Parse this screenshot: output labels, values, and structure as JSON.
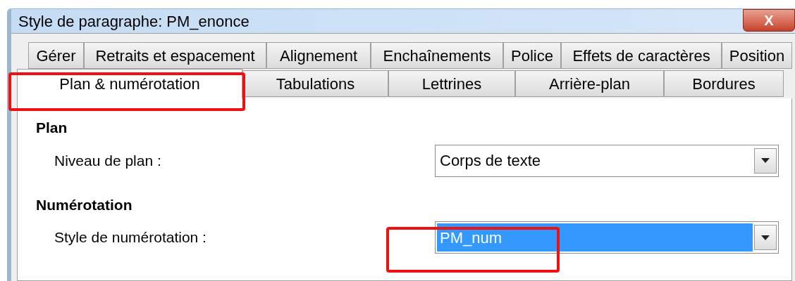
{
  "window": {
    "title": "Style de paragraphe: PM_enonce",
    "close_button": "X"
  },
  "tabs": [
    [
      {
        "label": "Gérer",
        "selected": false,
        "highlighted": false
      },
      {
        "label": "Retraits et espacement",
        "selected": false,
        "highlighted": false
      },
      {
        "label": "Alignement",
        "selected": false,
        "highlighted": false
      },
      {
        "label": "Enchaînements",
        "selected": false,
        "highlighted": false
      },
      {
        "label": "Police",
        "selected": false,
        "highlighted": false
      },
      {
        "label": "Effets de caractères",
        "selected": false,
        "highlighted": false
      },
      {
        "label": "Position",
        "selected": false,
        "highlighted": false
      }
    ],
    [
      {
        "label": "Plan & numérotation",
        "selected": true,
        "highlighted": true
      },
      {
        "label": "Tabulations",
        "selected": false,
        "highlighted": false
      },
      {
        "label": "Lettrines",
        "selected": false,
        "highlighted": false
      },
      {
        "label": "Arrière-plan",
        "selected": false,
        "highlighted": false
      },
      {
        "label": "Bordures",
        "selected": false,
        "highlighted": false
      }
    ]
  ],
  "sections": [
    {
      "heading": "Plan",
      "field": {
        "label": "Niveau de plan :",
        "value": "Corps de texte",
        "focused": false,
        "highlighted": false
      }
    },
    {
      "heading": "Numérotation",
      "field": {
        "label": "Style de numérotation :",
        "value": "PM_num",
        "focused": true,
        "highlighted": true
      }
    }
  ]
}
